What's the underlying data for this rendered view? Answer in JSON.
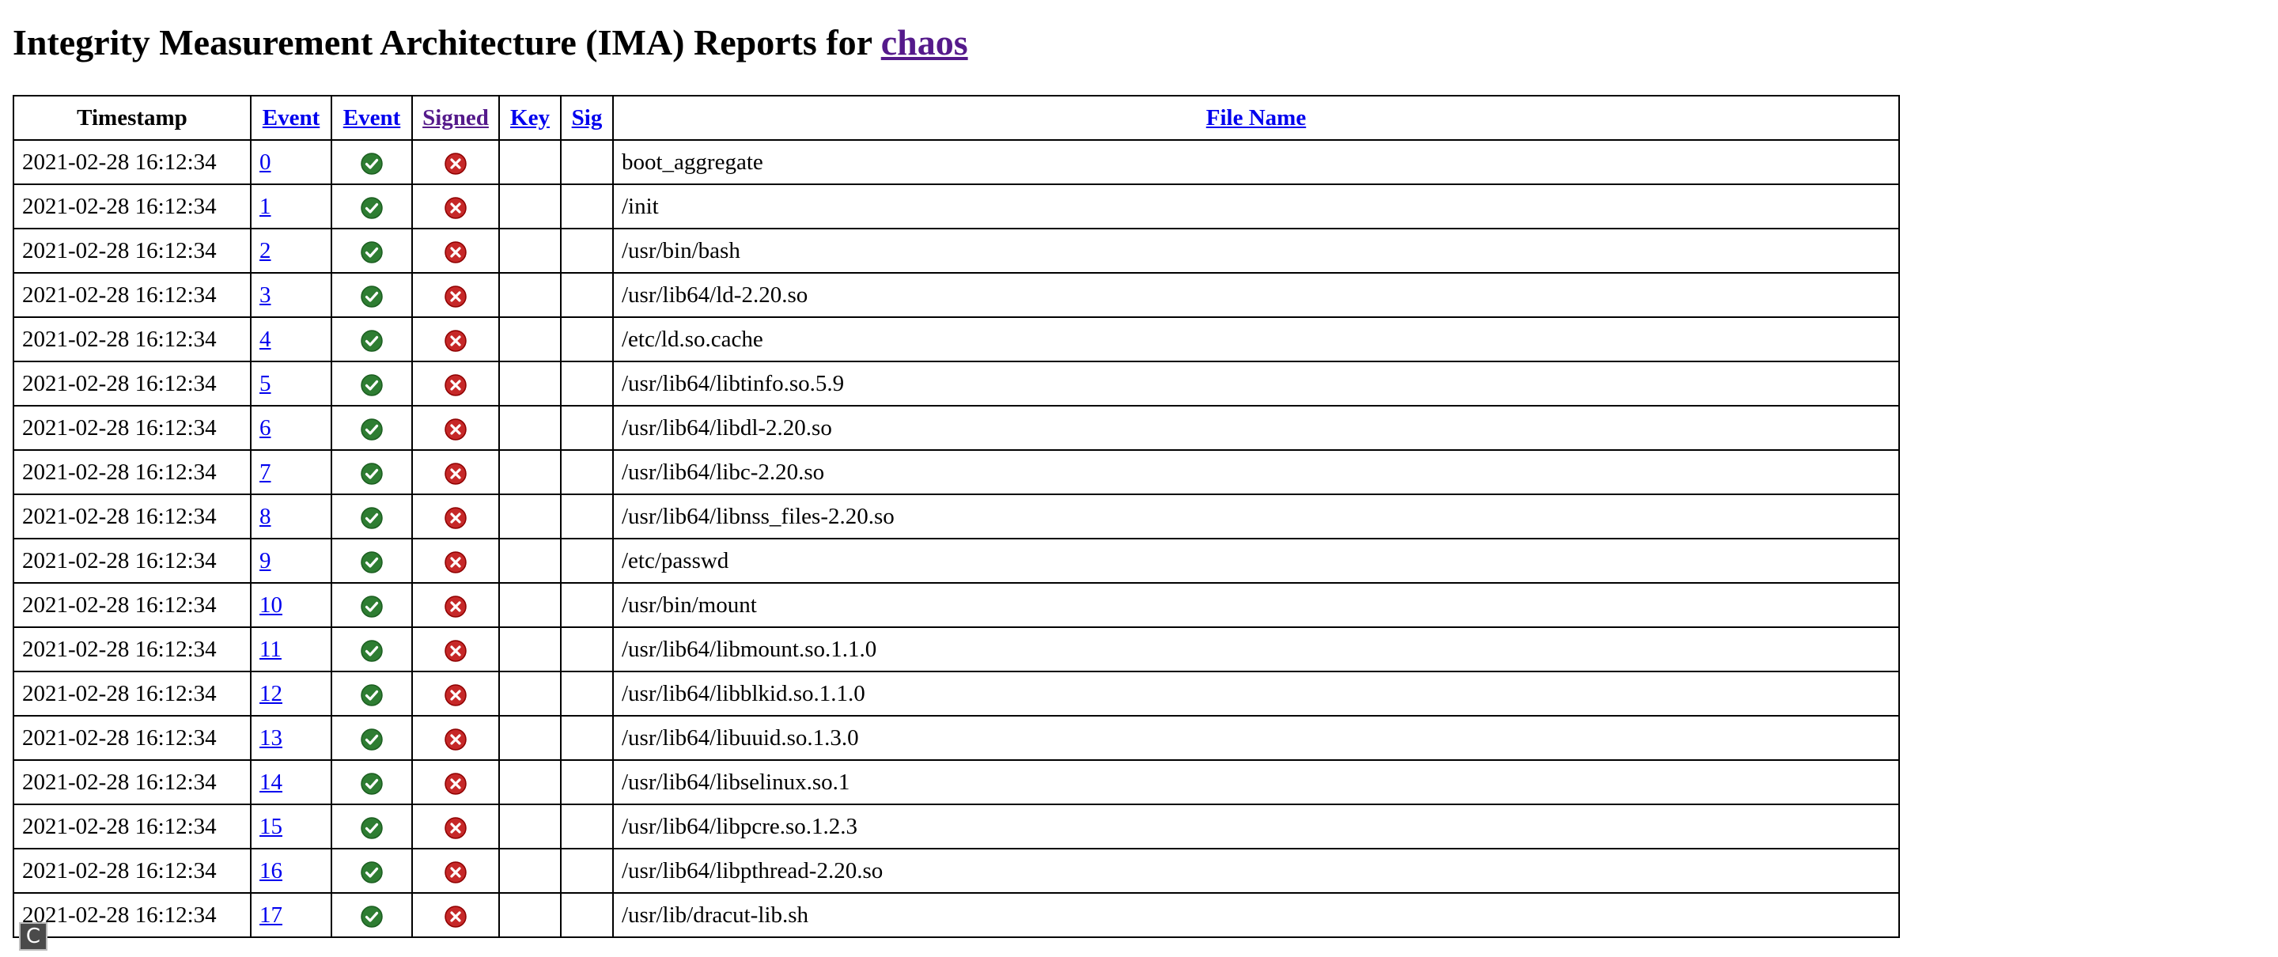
{
  "header": {
    "title_prefix": "Integrity Measurement Architecture (IMA) Reports for ",
    "host_link": "chaos"
  },
  "table": {
    "columns": [
      "Timestamp",
      "Event",
      "Event",
      "Signed",
      "Key",
      "Sig",
      "File Name"
    ],
    "rows": [
      {
        "timestamp": "2021-02-28 16:12:34",
        "event": "0",
        "file": "boot_aggregate"
      },
      {
        "timestamp": "2021-02-28 16:12:34",
        "event": "1",
        "file": "/init"
      },
      {
        "timestamp": "2021-02-28 16:12:34",
        "event": "2",
        "file": "/usr/bin/bash"
      },
      {
        "timestamp": "2021-02-28 16:12:34",
        "event": "3",
        "file": "/usr/lib64/ld-2.20.so"
      },
      {
        "timestamp": "2021-02-28 16:12:34",
        "event": "4",
        "file": "/etc/ld.so.cache"
      },
      {
        "timestamp": "2021-02-28 16:12:34",
        "event": "5",
        "file": "/usr/lib64/libtinfo.so.5.9"
      },
      {
        "timestamp": "2021-02-28 16:12:34",
        "event": "6",
        "file": "/usr/lib64/libdl-2.20.so"
      },
      {
        "timestamp": "2021-02-28 16:12:34",
        "event": "7",
        "file": "/usr/lib64/libc-2.20.so"
      },
      {
        "timestamp": "2021-02-28 16:12:34",
        "event": "8",
        "file": "/usr/lib64/libnss_files-2.20.so"
      },
      {
        "timestamp": "2021-02-28 16:12:34",
        "event": "9",
        "file": "/etc/passwd"
      },
      {
        "timestamp": "2021-02-28 16:12:34",
        "event": "10",
        "file": "/usr/bin/mount"
      },
      {
        "timestamp": "2021-02-28 16:12:34",
        "event": "11",
        "file": "/usr/lib64/libmount.so.1.1.0"
      },
      {
        "timestamp": "2021-02-28 16:12:34",
        "event": "12",
        "file": "/usr/lib64/libblkid.so.1.1.0"
      },
      {
        "timestamp": "2021-02-28 16:12:34",
        "event": "13",
        "file": "/usr/lib64/libuuid.so.1.3.0"
      },
      {
        "timestamp": "2021-02-28 16:12:34",
        "event": "14",
        "file": "/usr/lib64/libselinux.so.1"
      },
      {
        "timestamp": "2021-02-28 16:12:34",
        "event": "15",
        "file": "/usr/lib64/libpcre.so.1.2.3"
      },
      {
        "timestamp": "2021-02-28 16:12:34",
        "event": "16",
        "file": "/usr/lib64/libpthread-2.20.so"
      },
      {
        "timestamp": "2021-02-28 16:12:34",
        "event": "17",
        "file": "/usr/lib/dracut-lib.sh"
      }
    ]
  },
  "icons": {
    "event_ok": "check-circle-icon",
    "signed_fail": "x-circle-icon"
  },
  "colors": {
    "ok_green": "#2e7d32",
    "fail_red": "#c62828",
    "link": "#0000ee",
    "visited_link": "#551a8b"
  },
  "overlay": {
    "badge_letter": "C"
  }
}
